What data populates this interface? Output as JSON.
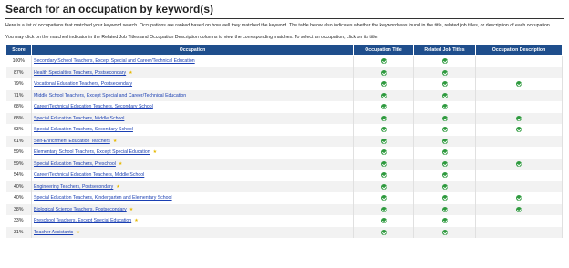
{
  "page": {
    "title": "Search for an occupation by keyword(s)",
    "intro": "Here is a list of occupations that matched your keyword search. Occupations are ranked based on how well they matched the keyword. The table below also indicates whether the keyword was found in the title, related job titles, or description of each occupation.",
    "instructions": "You may click on the matched indicator in the Related Job Titles and Occupation Description columns to view the corresponding matches. To select an occupation, click on its title."
  },
  "table": {
    "headers": {
      "score": "Score",
      "occupation": "Occupation",
      "title": "Occupation Title",
      "related": "Related Job Titles",
      "description": "Occupation Description"
    },
    "rows": [
      {
        "score": "100%",
        "occupation": "Secondary School Teachers, Except Special and Career/Technical Education",
        "star": false,
        "title": true,
        "related": true,
        "description": false
      },
      {
        "score": "87%",
        "occupation": "Health Specialties Teachers, Postsecondary",
        "star": true,
        "title": true,
        "related": true,
        "description": false
      },
      {
        "score": "79%",
        "occupation": "Vocational Education Teachers, Postsecondary",
        "star": false,
        "title": true,
        "related": true,
        "description": true
      },
      {
        "score": "71%",
        "occupation": "Middle School Teachers, Except Special and Career/Technical Education",
        "star": false,
        "title": true,
        "related": true,
        "description": false
      },
      {
        "score": "68%",
        "occupation": "Career/Technical Education Teachers, Secondary School",
        "star": false,
        "title": true,
        "related": true,
        "description": false
      },
      {
        "score": "68%",
        "occupation": "Special Education Teachers, Middle School",
        "star": false,
        "title": true,
        "related": true,
        "description": true
      },
      {
        "score": "63%",
        "occupation": "Special Education Teachers, Secondary School",
        "star": false,
        "title": true,
        "related": true,
        "description": true
      },
      {
        "score": "61%",
        "occupation": "Self-Enrichment Education Teachers",
        "star": true,
        "title": true,
        "related": true,
        "description": false
      },
      {
        "score": "59%",
        "occupation": "Elementary School Teachers, Except Special Education",
        "star": true,
        "title": true,
        "related": true,
        "description": false
      },
      {
        "score": "59%",
        "occupation": "Special Education Teachers, Preschool",
        "star": true,
        "title": true,
        "related": true,
        "description": true
      },
      {
        "score": "54%",
        "occupation": "Career/Technical Education Teachers, Middle School",
        "star": false,
        "title": true,
        "related": true,
        "description": false
      },
      {
        "score": "40%",
        "occupation": "Engineering Teachers, Postsecondary",
        "star": true,
        "title": true,
        "related": true,
        "description": false
      },
      {
        "score": "40%",
        "occupation": "Special Education Teachers, Kindergarten and Elementary School",
        "star": false,
        "title": true,
        "related": true,
        "description": true
      },
      {
        "score": "38%",
        "occupation": "Biological Science Teachers, Postsecondary",
        "star": true,
        "title": true,
        "related": true,
        "description": true
      },
      {
        "score": "33%",
        "occupation": "Preschool Teachers, Except Special Education",
        "star": true,
        "title": true,
        "related": true,
        "description": false
      },
      {
        "score": "31%",
        "occupation": "Teacher Assistants",
        "star": true,
        "title": true,
        "related": true,
        "description": false
      }
    ]
  },
  "icons": {
    "check": "check-circle-icon",
    "star": "bright-outlook-star-icon"
  },
  "colors": {
    "header_bg": "#1f4e8c",
    "check": "#2e9a3e",
    "link": "#1a3fb3",
    "star": "#e6b800"
  }
}
